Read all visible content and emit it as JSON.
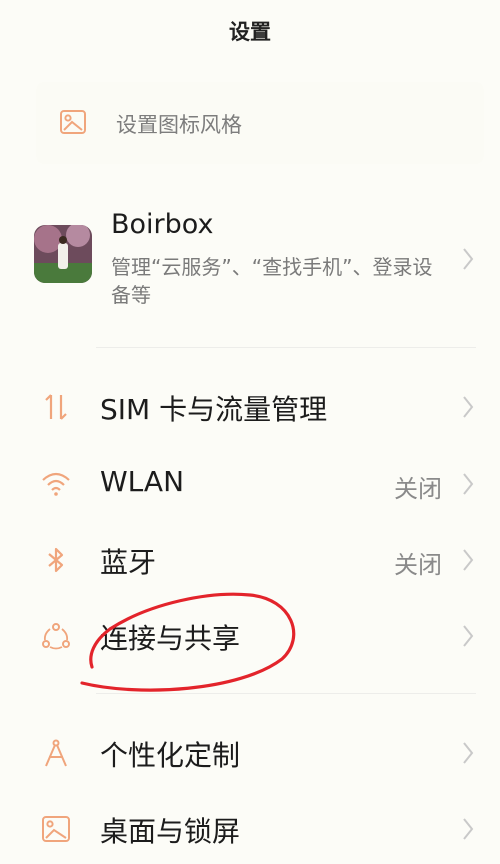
{
  "header": {
    "title": "设置"
  },
  "theme_card": {
    "label": "设置图标风格",
    "icon": "theme-image-icon"
  },
  "account": {
    "name": "Boirbox",
    "description": "管理“云服务”、“查找手机”、登录设备等"
  },
  "items": [
    {
      "label": "SIM 卡与流量管理",
      "value": "",
      "icon": "sim-data-icon"
    },
    {
      "label": "WLAN",
      "value": "关闭",
      "icon": "wifi-icon"
    },
    {
      "label": "蓝牙",
      "value": "关闭",
      "icon": "bluetooth-icon"
    },
    {
      "label": "连接与共享",
      "value": "",
      "icon": "share-connection-icon"
    },
    {
      "label": "个性化定制",
      "value": "",
      "icon": "personalization-icon"
    },
    {
      "label": "桌面与锁屏",
      "value": "",
      "icon": "desktop-lockscreen-icon"
    }
  ],
  "colors": {
    "accent": "#f0a57c",
    "annotation": "#e3242b",
    "chevron": "#c9c9c9"
  }
}
